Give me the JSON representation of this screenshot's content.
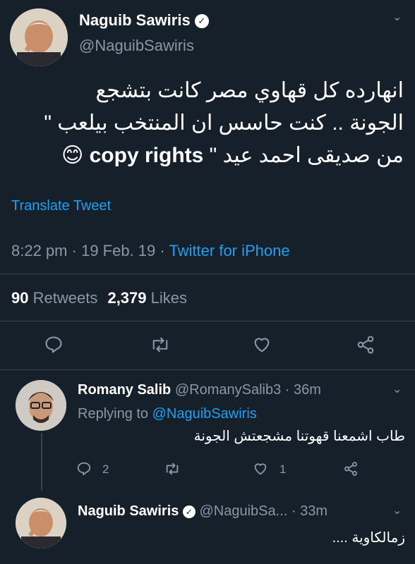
{
  "main_tweet": {
    "author_name": "Naguib Sawiris",
    "author_handle": "@NaguibSawiris",
    "text_line1": "انهارده كل قهاوي مصر كانت بتشجع",
    "text_line2": "الجونة .. كنت حاسس ان المنتخب بيلعب \"",
    "text_line3_arabic": "من صديقى احمد عيد \"",
    "text_line3_latin": "copy rights",
    "emoji": "😊",
    "translate_label": "Translate Tweet",
    "time": "8:22 pm",
    "date": "19 Feb. 19",
    "source": "Twitter for iPhone",
    "retweets_count": "90",
    "retweets_label": "Retweets",
    "likes_count": "2,379",
    "likes_label": "Likes"
  },
  "reply1": {
    "author_name": "Romany Salib",
    "author_handle": "@RomanySalib3",
    "time": "36m",
    "replying_prefix": "Replying to",
    "replying_handle": "@NaguibSawiris",
    "text": "طاب اشمعنا قهوتنا مشجعتش الجونة",
    "reply_count": "2",
    "like_count": "1"
  },
  "reply2": {
    "author_name": "Naguib Sawiris",
    "author_handle": "@NaguibSa...",
    "time": "33m",
    "text": "زمالكاوية ...."
  },
  "colors": {
    "background": "#15202b",
    "accent": "#1da1f2",
    "muted": "#8899a6",
    "divider": "#38444d"
  }
}
